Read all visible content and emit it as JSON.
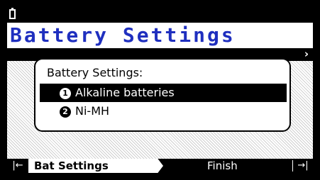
{
  "status_bar": {
    "icon": "battery-icon"
  },
  "header": {
    "title": "Battery Settings"
  },
  "nav": {
    "next_icon": "chevron-right-icon",
    "next_glyph": "›"
  },
  "dialog": {
    "title": "Battery Settings:",
    "options": [
      {
        "number": "1",
        "label": "Alkaline batteries",
        "selected": true
      },
      {
        "number": "2",
        "label": "Ni-MH",
        "selected": false
      }
    ]
  },
  "softkeys": {
    "prev_icon": "first-step-icon",
    "prev_glyph": "|←",
    "active_tab": "Bat Settings",
    "next_tab": "Finish",
    "next_icon": "last-step-icon",
    "next_glyph": "→|"
  },
  "colors": {
    "title": "#1f2fbf",
    "bezel": "#000000",
    "highlight": "#000000"
  }
}
